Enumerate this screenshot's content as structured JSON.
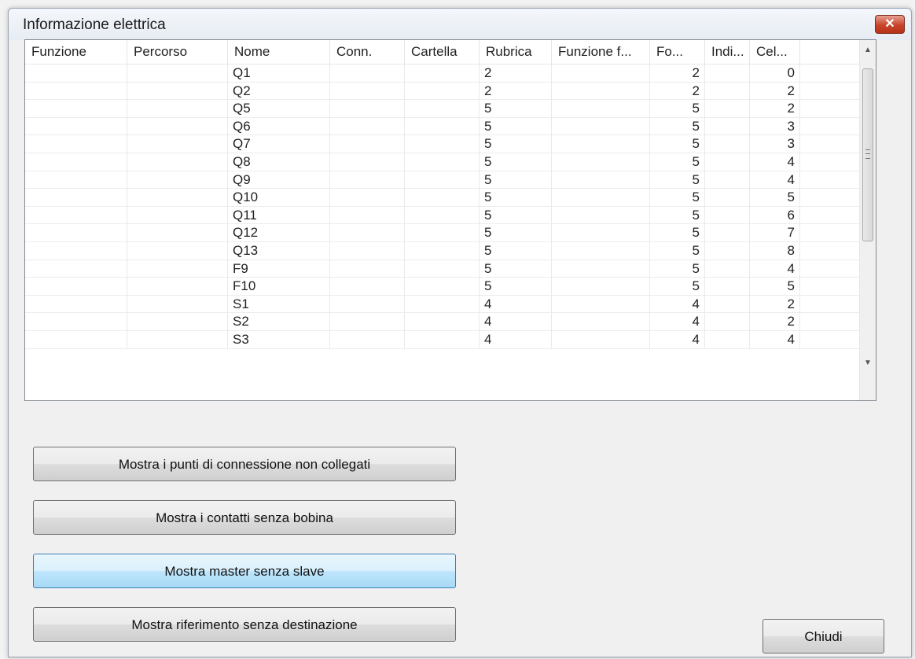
{
  "window": {
    "title": "Informazione elettrica",
    "close_icon": "close-icon"
  },
  "table": {
    "columns": [
      "Funzione",
      "Percorso",
      "Nome",
      "Conn.",
      "Cartella",
      "Rubrica",
      "Funzione f...",
      "Fo...",
      "Indi...",
      "Cel...",
      ""
    ],
    "rows": [
      [
        "",
        "",
        "Q1",
        "",
        "",
        "2",
        "",
        "2",
        "",
        "0",
        ""
      ],
      [
        "",
        "",
        "Q2",
        "",
        "",
        "2",
        "",
        "2",
        "",
        "2",
        ""
      ],
      [
        "",
        "",
        "Q5",
        "",
        "",
        "5",
        "",
        "5",
        "",
        "2",
        ""
      ],
      [
        "",
        "",
        "Q6",
        "",
        "",
        "5",
        "",
        "5",
        "",
        "3",
        ""
      ],
      [
        "",
        "",
        "Q7",
        "",
        "",
        "5",
        "",
        "5",
        "",
        "3",
        ""
      ],
      [
        "",
        "",
        "Q8",
        "",
        "",
        "5",
        "",
        "5",
        "",
        "4",
        ""
      ],
      [
        "",
        "",
        "Q9",
        "",
        "",
        "5",
        "",
        "5",
        "",
        "4",
        ""
      ],
      [
        "",
        "",
        "Q10",
        "",
        "",
        "5",
        "",
        "5",
        "",
        "5",
        ""
      ],
      [
        "",
        "",
        "Q11",
        "",
        "",
        "5",
        "",
        "5",
        "",
        "6",
        ""
      ],
      [
        "",
        "",
        "Q12",
        "",
        "",
        "5",
        "",
        "5",
        "",
        "7",
        ""
      ],
      [
        "",
        "",
        "Q13",
        "",
        "",
        "5",
        "",
        "5",
        "",
        "8",
        ""
      ],
      [
        "",
        "",
        "F9",
        "",
        "",
        "5",
        "",
        "5",
        "",
        "4",
        ""
      ],
      [
        "",
        "",
        "F10",
        "",
        "",
        "5",
        "",
        "5",
        "",
        "5",
        ""
      ],
      [
        "",
        "",
        "S1",
        "",
        "",
        "4",
        "",
        "4",
        "",
        "2",
        ""
      ],
      [
        "",
        "",
        "S2",
        "",
        "",
        "4",
        "",
        "4",
        "",
        "2",
        ""
      ],
      [
        "",
        "",
        "S3",
        "",
        "",
        "4",
        "",
        "4",
        "",
        "4",
        ""
      ]
    ]
  },
  "buttons": {
    "unconnected": "Mostra i punti di connessione non collegati",
    "no_coil": "Mostra i contatti senza bobina",
    "master_no_slave": "Mostra master senza slave",
    "ref_no_target": "Mostra riferimento senza destinazione",
    "close": "Chiudi"
  }
}
